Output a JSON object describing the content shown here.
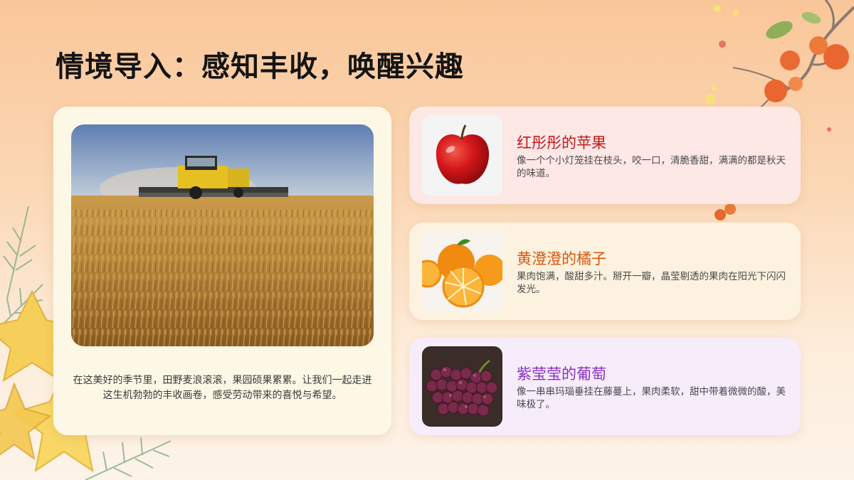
{
  "slide": {
    "title": "情境导入：感知丰收，唤醒兴趣"
  },
  "left_card": {
    "photo_icon": "wheat-harvester-photo",
    "caption": "在这美好的季节里，田野麦浪滚滚，果园硕果累累。让我们一起走进这生机勃勃的丰收画卷，感受劳动带来的喜悦与希望。"
  },
  "fruits": [
    {
      "name": "红彤彤的苹果",
      "desc": "像一个个小灯笼挂在枝头，咬一口，清脆香甜，满满的都是秋天的味道。",
      "name_color": "#c0181b",
      "card_color": "#fde8e6",
      "icon": "apple-photo"
    },
    {
      "name": "黄澄澄的橘子",
      "desc": "果肉饱满，酸甜多汁。掰开一瓣，晶莹剔透的果肉在阳光下闪闪发光。",
      "name_color": "#d9560e",
      "card_color": "#fdf2df",
      "icon": "orange-photo"
    },
    {
      "name": "紫莹莹的葡萄",
      "desc": "像一串串玛瑙垂挂在藤蔓上，果肉柔软，甜中带着微微的酸，美味极了。",
      "name_color": "#8a2fc4",
      "card_color": "#f6ecfa",
      "icon": "grapes-photo"
    }
  ]
}
